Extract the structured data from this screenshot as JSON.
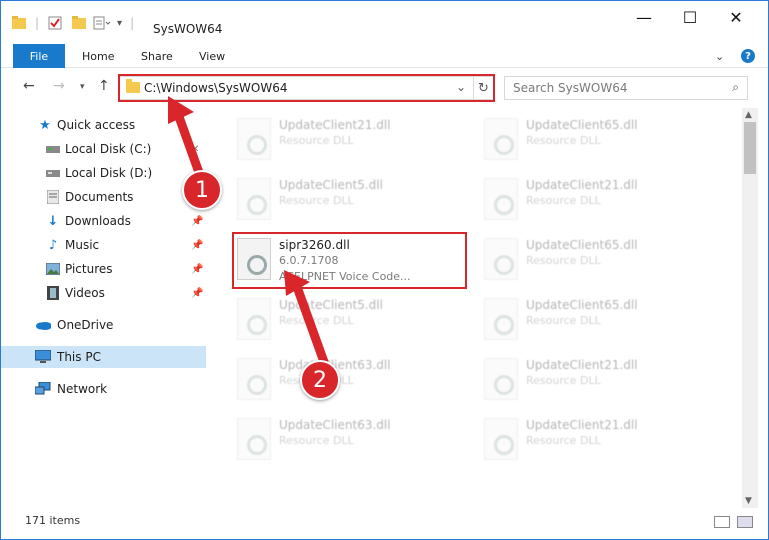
{
  "window": {
    "title": "SysWOW64",
    "minimize": "—",
    "maximize": "☐",
    "close": "✕"
  },
  "ribbon": {
    "tabs": [
      "File",
      "Home",
      "Share",
      "View"
    ],
    "help": "?"
  },
  "address_bar": {
    "path": "C:\\Windows\\SysWOW64",
    "search_placeholder": "Search SysWOW64"
  },
  "sidebar": {
    "items": [
      {
        "label": "Quick access",
        "icon": "star-icon"
      },
      {
        "label": "Local Disk (C:)",
        "icon": "drive-icon"
      },
      {
        "label": "Local Disk (D:)",
        "icon": "drive-icon"
      },
      {
        "label": "Documents",
        "icon": "documents-icon"
      },
      {
        "label": "Downloads",
        "icon": "download-icon"
      },
      {
        "label": "Music",
        "icon": "music-icon"
      },
      {
        "label": "Pictures",
        "icon": "pictures-icon"
      },
      {
        "label": "Videos",
        "icon": "videos-icon"
      },
      {
        "label": "OneDrive",
        "icon": "cloud-icon"
      },
      {
        "label": "This PC",
        "icon": "pc-icon"
      },
      {
        "label": "Network",
        "icon": "network-icon"
      }
    ]
  },
  "files": [
    {
      "name": "UpdateClient21.dll",
      "line2": "Resource DLL",
      "line3": ""
    },
    {
      "name": "UpdateClient65.dll",
      "line2": "Resource DLL",
      "line3": ""
    },
    {
      "name": "UpdateClient5.dll",
      "line2": "Resource DLL",
      "line3": ""
    },
    {
      "name": "UpdateClient21.dll",
      "line2": "Resource DLL",
      "line3": ""
    },
    {
      "name": "sipr3260.dll",
      "line2": "6.0.7.1708",
      "line3": "ACELPNET Voice Code..."
    },
    {
      "name": "UpdateClient65.dll",
      "line2": "Resource DLL",
      "line3": ""
    },
    {
      "name": "UpdateClient5.dll",
      "line2": "Resource DLL",
      "line3": ""
    },
    {
      "name": "UpdateClient65.dll",
      "line2": "Resource DLL",
      "line3": ""
    },
    {
      "name": "UpdateClient63.dll",
      "line2": "Resource DLL",
      "line3": ""
    },
    {
      "name": "UpdateClient21.dll",
      "line2": "Resource DLL",
      "line3": ""
    },
    {
      "name": "UpdateClient63.dll",
      "line2": "Resource DLL",
      "line3": ""
    },
    {
      "name": "UpdateClient21.dll",
      "line2": "Resource DLL",
      "line3": ""
    }
  ],
  "status": {
    "item_count": "171 items"
  },
  "annotations": {
    "step1": "1",
    "step2": "2",
    "color": "#d8262b"
  }
}
